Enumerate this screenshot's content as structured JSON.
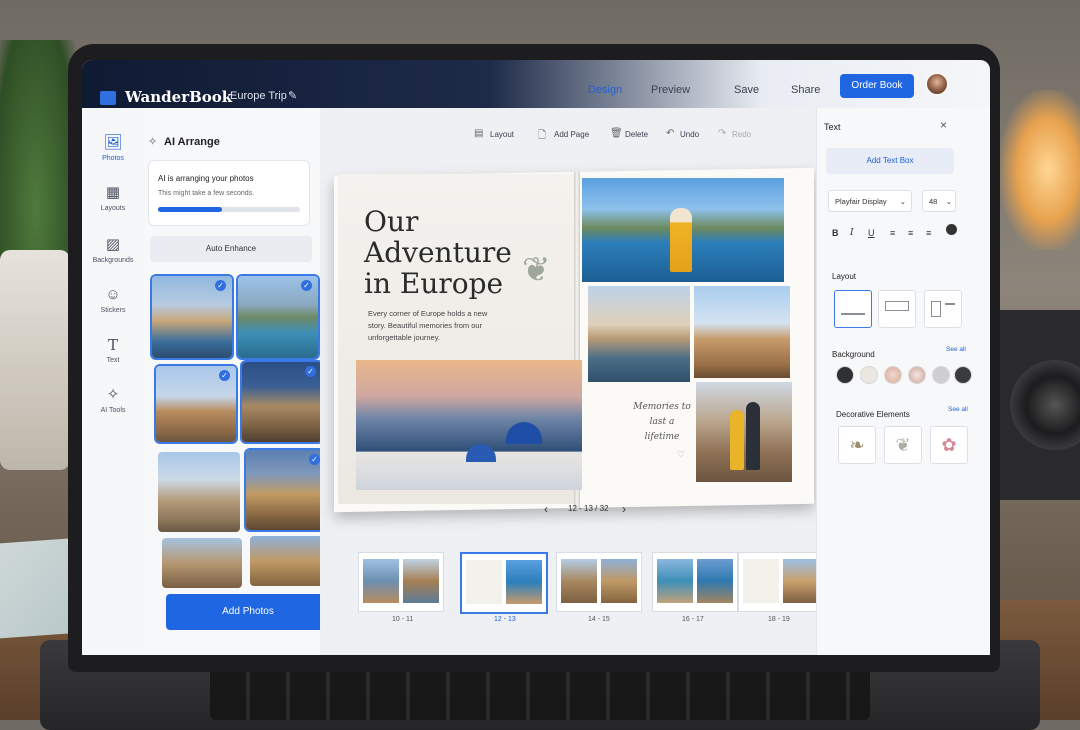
{
  "topbar": {
    "app_name": "WanderBook",
    "project_name": "Europe Trip",
    "nav": {
      "design": "Design",
      "preview": "Preview",
      "save": "Save",
      "share": "Share"
    },
    "order_button": "Order Book",
    "active_tab": "Design"
  },
  "rail": {
    "items": [
      {
        "label": "Photos",
        "icon": "image-icon"
      },
      {
        "label": "Layouts",
        "icon": "grid-icon"
      },
      {
        "label": "Backgrounds",
        "icon": "texture-icon"
      },
      {
        "label": "Stickers",
        "icon": "smiley-icon"
      },
      {
        "label": "Text",
        "icon": "text-icon"
      },
      {
        "label": "AI Tools",
        "icon": "sparkle-icon"
      }
    ]
  },
  "left_panel": {
    "title": "AI Arrange",
    "status_title": "AI is arranging your photos",
    "status_sub": "This might take a few seconds.",
    "progress": 0.45,
    "enhance_button": "Auto Enhance",
    "add_photos_button": "Add Photos"
  },
  "toolbar": {
    "layout": "Layout",
    "add_page": "Add Page",
    "delete": "Delete",
    "undo": "Undo",
    "redo": "Redo"
  },
  "spread": {
    "headline_lines": [
      "Our",
      "Adventure",
      "in Europe"
    ],
    "body": "Every corner of Europe holds a new story. Beautiful memories from our unforgettable journey.",
    "handwriting": "Memories to last a lifetime",
    "page_indicator": "12 - 13 / 32"
  },
  "thumbnails": {
    "labels": [
      "10 - 11",
      "12 - 13",
      "14 - 15",
      "16 - 17",
      "18 - 19"
    ],
    "active": "12 - 13"
  },
  "right_panel": {
    "title": "Text",
    "add_text_box": "Add Text Box",
    "font": "Playfair Display",
    "size": "48",
    "format_buttons": [
      "B",
      "I",
      "U"
    ],
    "layout_title": "Layout",
    "background_title": "Background",
    "background_see_all": "See all",
    "decorative_title": "Decorative Elements",
    "decorative_see_all": "See all"
  },
  "colors": {
    "accent": "#1f66e3",
    "topbar_dark": "#0f1a33"
  }
}
